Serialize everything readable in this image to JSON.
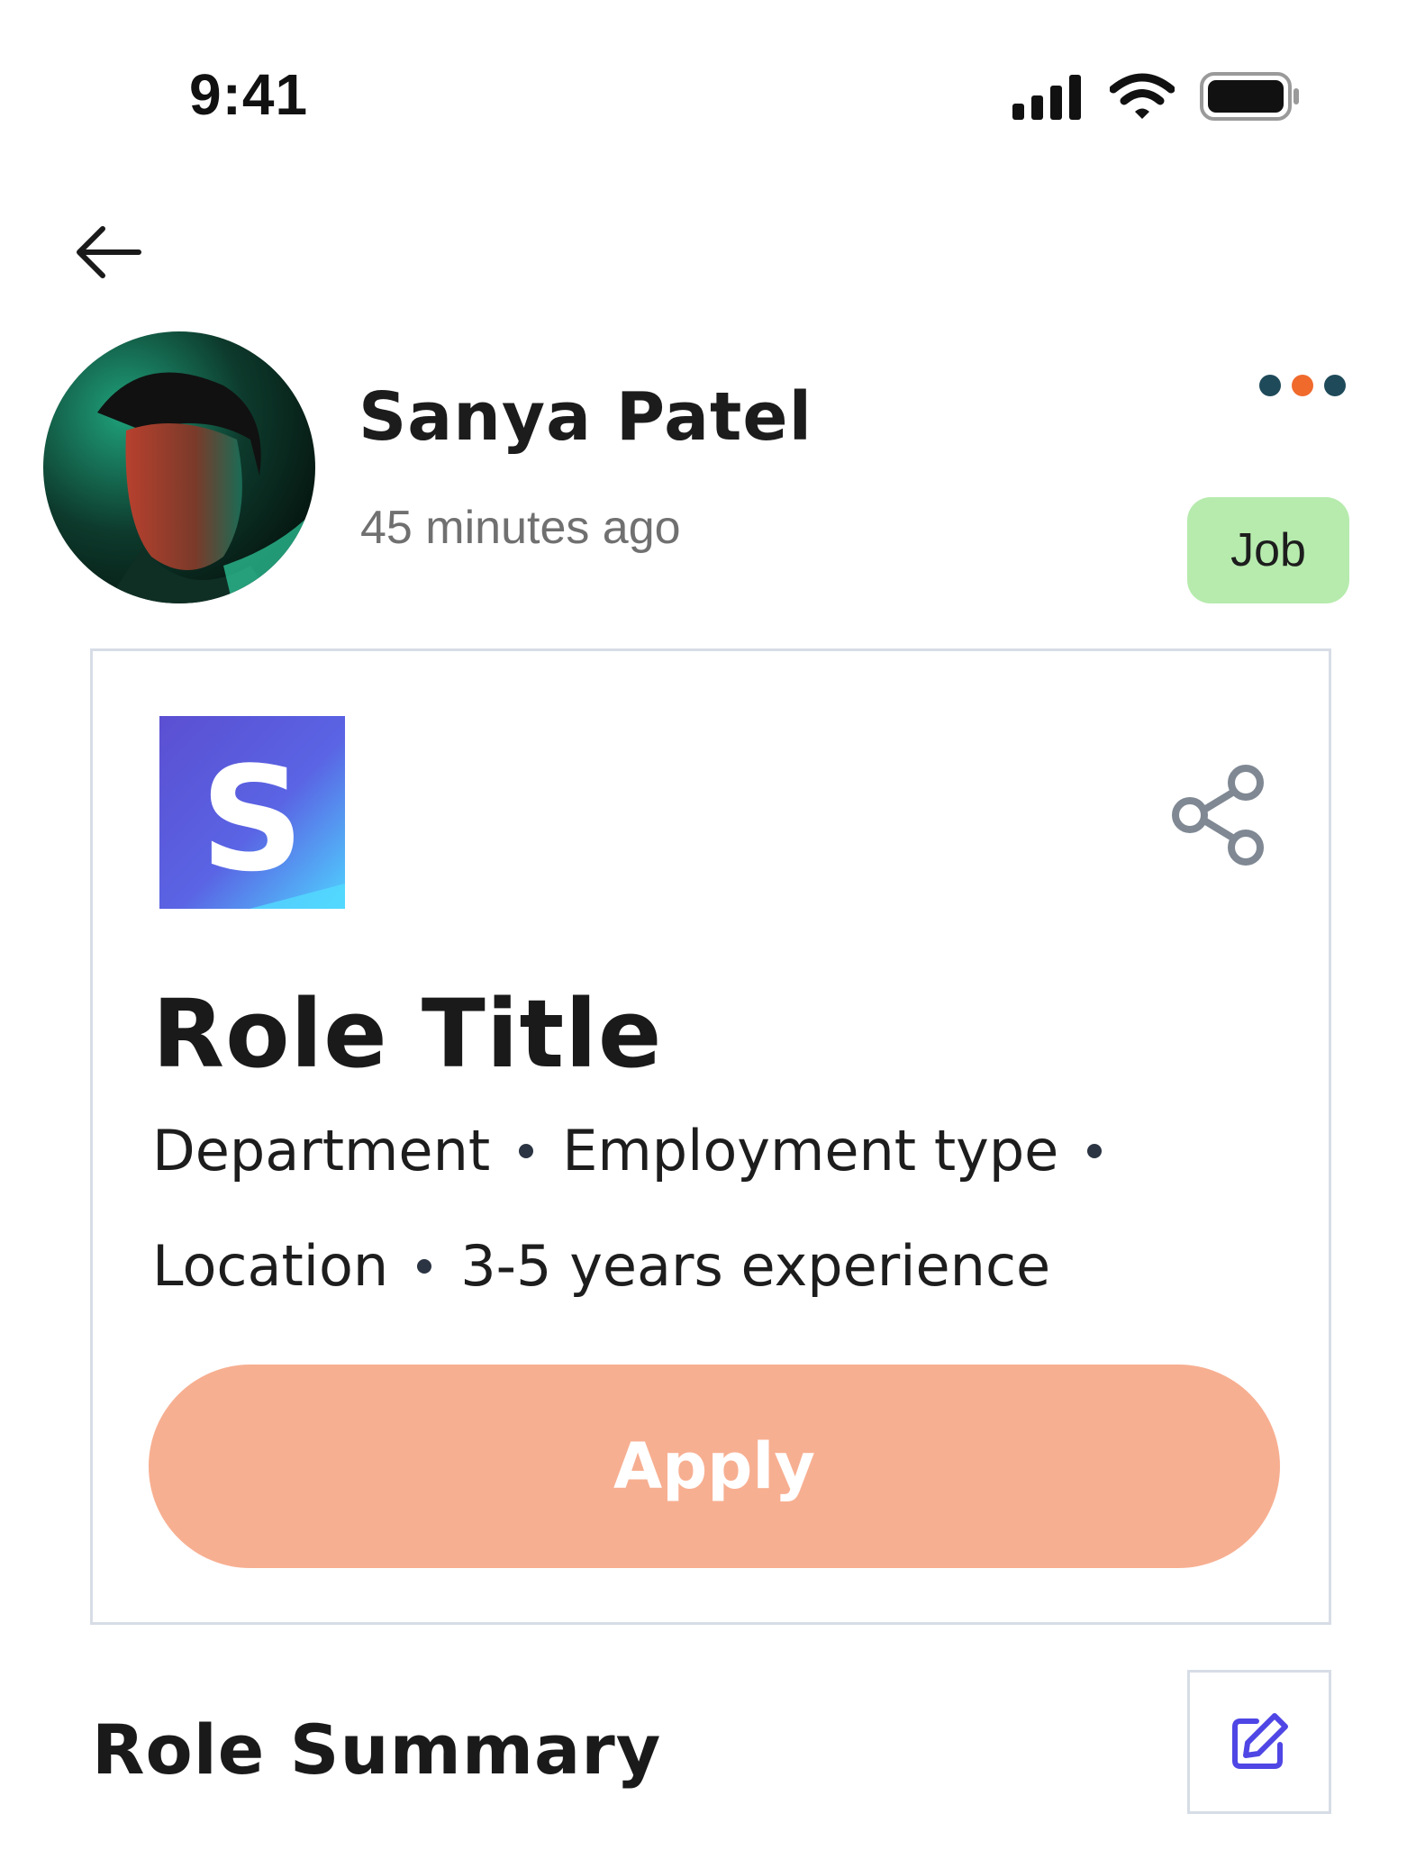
{
  "status_bar": {
    "time": "9:41",
    "icons": [
      "signal-icon",
      "wifi-icon",
      "battery-icon"
    ]
  },
  "nav": {
    "back_icon": "arrow-left-icon"
  },
  "post": {
    "author_name": "Sanya Patel",
    "timestamp": "45 minutes ago",
    "badge": "Job",
    "more_icon": "more-dots-icon",
    "colors": {
      "badge_bg": "#b6ebad",
      "dot_dark": "#1f4a5a",
      "dot_accent": "#f06a2c"
    }
  },
  "job_card": {
    "logo_letter": "S",
    "share_icon": "share-icon",
    "role_title": "Role Title",
    "meta": {
      "department": "Department",
      "employment_type": "Employment type",
      "location": "Location",
      "experience": "3-5 years experience"
    },
    "apply_label": "Apply",
    "colors": {
      "apply_bg": "#f7af91",
      "logo_start": "#5b4fd2",
      "logo_end": "#4fd3ff"
    }
  },
  "summary": {
    "title": "Role Summary",
    "edit_icon": "edit-icon",
    "colors": {
      "edit_icon": "#4f46e5"
    }
  }
}
